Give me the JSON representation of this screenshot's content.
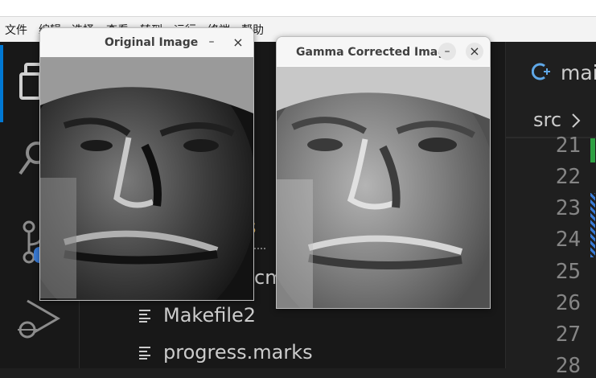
{
  "menubar": {
    "items": [
      "文件",
      "编辑",
      "选择",
      "查看",
      "转到",
      "运行",
      "终端",
      "帮助"
    ]
  },
  "explorer": {
    "visible_fragments": [
      "s",
      "cm",
      ")"
    ],
    "files": [
      {
        "name": "Makefile2",
        "icon": "file-lines-icon"
      },
      {
        "name": "progress.marks",
        "icon": "file-lines-icon"
      }
    ]
  },
  "editor": {
    "tab_label": "mai",
    "tab_icon": "cpp-icon",
    "breadcrumb": "src",
    "line_numbers": [
      "21",
      "22",
      "23",
      "24",
      "25",
      "26",
      "27",
      "28"
    ]
  },
  "windows": {
    "original": {
      "title": "Original Image",
      "minimize_label": "–",
      "close_label": "×"
    },
    "gamma": {
      "title": "Gamma Corrected Image",
      "minimize_label": "–",
      "close_label": "×"
    }
  },
  "colors": {
    "accent": "#0078d4",
    "git_added": "#2ea043",
    "git_modified": "#3a7bd5",
    "badge": "#3a7bd5"
  }
}
